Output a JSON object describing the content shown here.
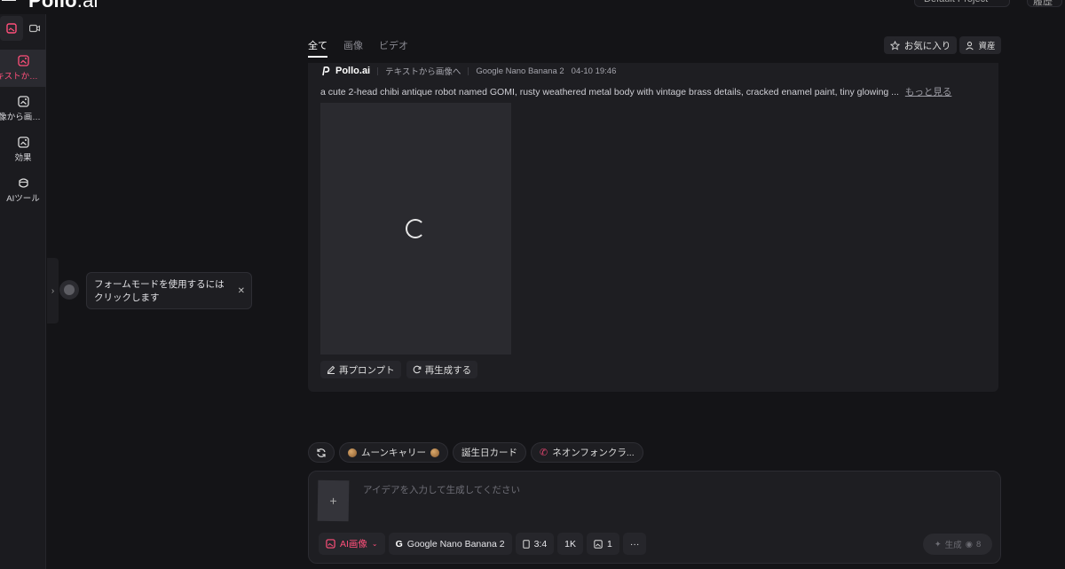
{
  "header": {
    "logo_main": "Pollo",
    "logo_suffix": ".ai",
    "project_btn": "Default Project",
    "history_btn": "履歴"
  },
  "rail": {
    "items": [
      {
        "label": "テキストから画像へ",
        "active": true,
        "icon": "text-to-image-icon"
      },
      {
        "label": "画像から画像へ",
        "icon": "image-to-image-icon"
      },
      {
        "label": "効果",
        "icon": "effects-icon"
      },
      {
        "label": "AIツール",
        "icon": "ai-tools-icon"
      }
    ]
  },
  "tabs": [
    "全て",
    "画像",
    "ビデオ"
  ],
  "actions": {
    "favorites": "お気に入り",
    "assets": "資産"
  },
  "card": {
    "brand": "Pollo.ai",
    "mode": "テキストから画像へ",
    "model": "Google Nano Banana 2",
    "timestamp": "04-10 19:46",
    "prompt": "a cute 2-head chibi antique robot named GOMI, rusty weathered metal body with vintage brass details, cracked enamel paint, tiny glowing ...",
    "more": "もっと見る",
    "reprompt": "再プロンプト",
    "regenerate": "再生成する"
  },
  "tooltip": {
    "text": "フォームモードを使用するにはクリックします"
  },
  "suggestions": [
    "ムーンキャリー",
    "誕生日カード",
    "ネオンフォンクラ..."
  ],
  "composer": {
    "placeholder": "アイデアを入力して生成してください",
    "mode": "AI画像",
    "model": "Google Nano Banana 2",
    "ratio": "3:4",
    "resolution": "1K",
    "count": "1",
    "more": "···",
    "generate": "生成",
    "credits": "8"
  },
  "colors": {
    "accent": "#ff4f7a",
    "bg": "#141417",
    "panel": "#1e1e22"
  }
}
